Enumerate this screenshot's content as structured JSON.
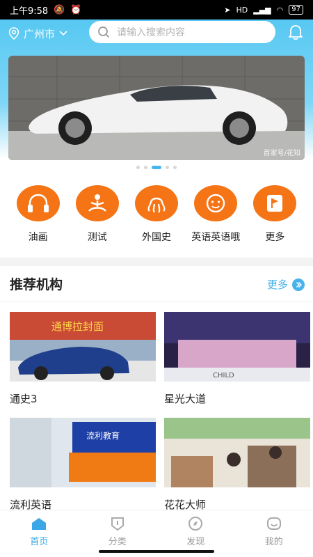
{
  "status_bar": {
    "time": "上午9:58",
    "battery": "97",
    "network": "HD"
  },
  "header": {
    "city": "广州市",
    "search_placeholder": "请输入搜索内容"
  },
  "banner": {
    "credit": "百家号/花知",
    "dots": 5,
    "active_dot": 3
  },
  "categories": [
    {
      "label": "油画",
      "icon": "headphones-icon"
    },
    {
      "label": "测试",
      "icon": "meditation-icon"
    },
    {
      "label": "外国史",
      "icon": "octopus-icon"
    },
    {
      "label": "英语英语哦",
      "icon": "baby-face-icon"
    },
    {
      "label": "更多",
      "icon": "flag-icon"
    }
  ],
  "section": {
    "title": "推荐机构",
    "more": "更多"
  },
  "institutions": [
    {
      "name": "通史3",
      "image_text": "通博拉封面"
    },
    {
      "name": "星光大道",
      "image_text": "CHILD"
    },
    {
      "name": "流利英语",
      "image_text": "流利教育"
    },
    {
      "name": "花花大师",
      "image_text": ""
    }
  ],
  "tabs": [
    {
      "label": "首页",
      "active": true,
      "icon": "home-icon"
    },
    {
      "label": "分类",
      "active": false,
      "icon": "category-icon"
    },
    {
      "label": "发现",
      "active": false,
      "icon": "compass-icon"
    },
    {
      "label": "我的",
      "active": false,
      "icon": "profile-icon"
    }
  ],
  "colors": {
    "accent": "#3aa7e6",
    "category_orange": "#f57416",
    "header_blue": "#57c8f2"
  }
}
